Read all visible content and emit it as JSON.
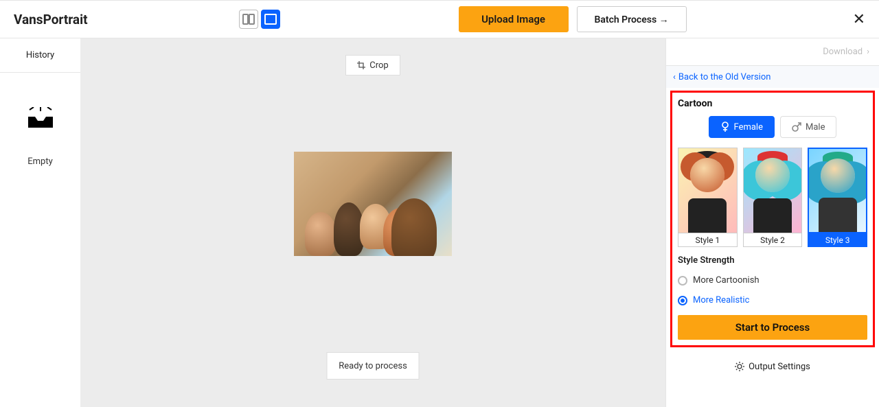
{
  "header": {
    "title": "VansPortrait",
    "upload": "Upload Image",
    "batch": "Batch Process →"
  },
  "sidebar": {
    "history": "History",
    "empty": "Empty"
  },
  "canvas": {
    "crop": "Crop",
    "ready": "Ready to process"
  },
  "right": {
    "download": "Download",
    "back": "Back to the Old Version",
    "cartoon_title": "Cartoon",
    "female": "Female",
    "male": "Male",
    "styles": [
      "Style 1",
      "Style 2",
      "Style 3"
    ],
    "strength_title": "Style Strength",
    "strength_opts": [
      "More Cartoonish",
      "More Realistic"
    ],
    "process": "Start to Process",
    "output": "Output Settings"
  }
}
